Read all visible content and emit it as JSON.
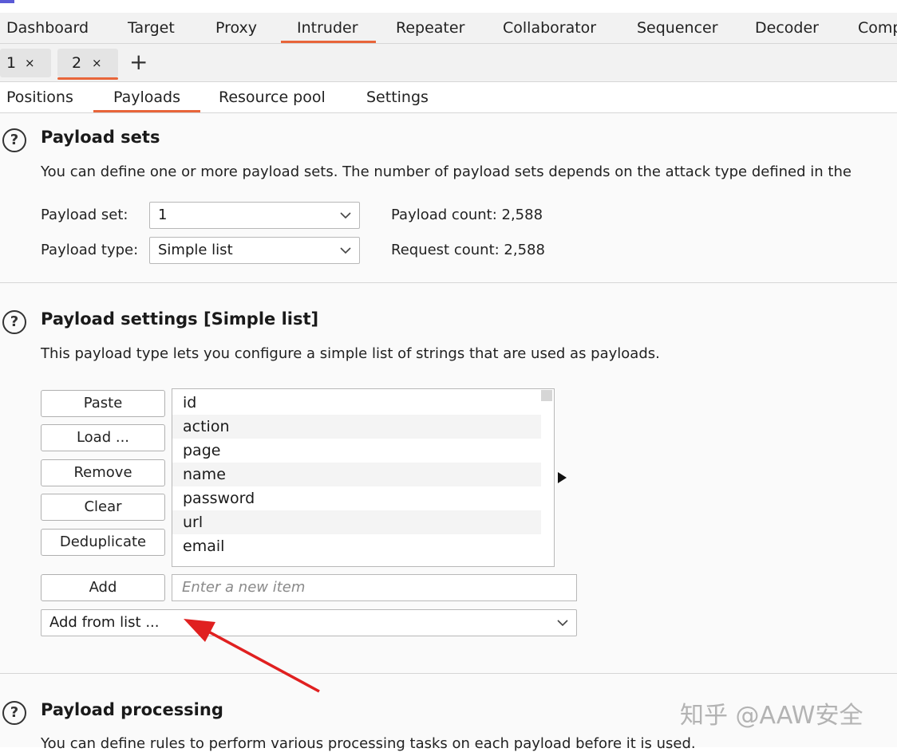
{
  "nav": {
    "tabs": [
      "Dashboard",
      "Target",
      "Proxy",
      "Intruder",
      "Repeater",
      "Collaborator",
      "Sequencer",
      "Decoder",
      "Comp"
    ],
    "active": "Intruder"
  },
  "sessions": {
    "tabs": [
      {
        "label": "1",
        "close": "×"
      },
      {
        "label": "2",
        "close": "×"
      }
    ],
    "active": "2",
    "add": "+"
  },
  "subtabs": {
    "items": [
      "Positions",
      "Payloads",
      "Resource pool",
      "Settings"
    ],
    "active": "Payloads"
  },
  "payload_sets": {
    "help": "?",
    "title": "Payload sets",
    "description": "You can define one or more payload sets. The number of payload sets depends on the attack type defined in the",
    "set_label": "Payload set:",
    "set_value": "1",
    "type_label": "Payload type:",
    "type_value": "Simple list",
    "payload_count": "Payload count: 2,588",
    "request_count": "Request count: 2,588"
  },
  "payload_settings": {
    "help": "?",
    "title": "Payload settings [Simple list]",
    "description": "This payload type lets you configure a simple list of strings that are used as payloads.",
    "buttons": {
      "paste": "Paste",
      "load": "Load ...",
      "remove": "Remove",
      "clear": "Clear",
      "deduplicate": "Deduplicate",
      "add": "Add"
    },
    "items": [
      "id",
      "action",
      "page",
      "name",
      "password",
      "url",
      "email"
    ],
    "new_item_placeholder": "Enter a new item",
    "add_from_list": "Add from list ..."
  },
  "payload_processing": {
    "help": "?",
    "title": "Payload processing",
    "description": "You can define rules to perform various processing tasks on each payload before it is used."
  },
  "watermark": "知乎 @AAW安全",
  "colors": {
    "accent": "#e8653a",
    "arrow": "#e02020"
  }
}
